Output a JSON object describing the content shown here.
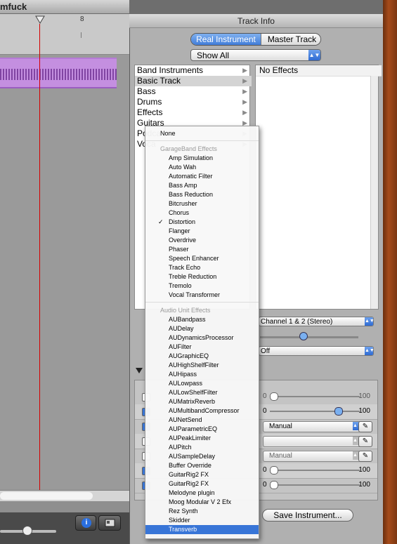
{
  "window": {
    "title_fragment": "mfuck"
  },
  "ruler": {
    "marker": "8"
  },
  "panel": {
    "title": "Track Info",
    "segments": [
      "Real Instrument",
      "Master Track"
    ],
    "filter": "Show All",
    "categories": [
      {
        "label": "Band Instruments",
        "selected": false
      },
      {
        "label": "Basic Track",
        "selected": true
      },
      {
        "label": "Bass",
        "selected": false
      },
      {
        "label": "Drums",
        "selected": false
      },
      {
        "label": "Effects",
        "selected": false
      },
      {
        "label": "Guitars",
        "selected": false
      },
      {
        "label": "Podca",
        "selected": false
      },
      {
        "label": "Voca",
        "selected": false
      }
    ],
    "effects_header": "No Effects",
    "input_source": "Channel 1 & 2 (Stereo)",
    "monitor": "Off",
    "save_button": "Save Instrument..."
  },
  "effects_rows": [
    {
      "checked": false,
      "type": "slider",
      "min": "0",
      "max": "100",
      "value": 0.0,
      "dim": true
    },
    {
      "checked": true,
      "type": "slider",
      "min": "0",
      "max": "100",
      "value": 0.78,
      "dim": false
    },
    {
      "checked": true,
      "type": "select",
      "value": "Manual",
      "dim": false
    },
    {
      "checked": false,
      "type": "select",
      "value": "",
      "dim": true
    },
    {
      "checked": false,
      "type": "select",
      "value": "Manual",
      "dim": true
    },
    {
      "checked": true,
      "type": "slider",
      "min": "0",
      "max": "100",
      "value": 0.0,
      "dim": false
    },
    {
      "checked": true,
      "type": "slider",
      "min": "0",
      "max": "100",
      "value": 0.0,
      "dim": false
    }
  ],
  "menu": {
    "none": "None",
    "garageband_header": "GarageBand Effects",
    "garageband": [
      "Amp Simulation",
      "Auto Wah",
      "Automatic Filter",
      "Bass Amp",
      "Bass Reduction",
      "Bitcrusher",
      "Chorus",
      "Distortion",
      "Flanger",
      "Overdrive",
      "Phaser",
      "Speech Enhancer",
      "Track Echo",
      "Treble Reduction",
      "Tremolo",
      "Vocal Transformer"
    ],
    "checked_item": "Distortion",
    "audiounit_header": "Audio Unit Effects",
    "audiounit": [
      "AUBandpass",
      "AUDelay",
      "AUDynamicsProcessor",
      "AUFilter",
      "AUGraphicEQ",
      "AUHighShelfFilter",
      "AUHipass",
      "AULowpass",
      "AULowShelfFilter",
      "AUMatrixReverb",
      "AUMultibandCompressor",
      "AUNetSend",
      "AUParametricEQ",
      "AUPeakLimiter",
      "AUPitch",
      "AUSampleDelay",
      "Buffer Override",
      "GuitarRig2 FX",
      "GuitarRig2 FX",
      "Melodyne plugin",
      "Moog Modular V 2 Efx",
      "Rez Synth",
      "Skidder",
      "Transverb"
    ],
    "highlighted_item": "Transverb"
  },
  "icons": {
    "info": "info-icon",
    "media": "media-browser-icon",
    "pencil": "pencil-icon"
  },
  "colors": {
    "accent": "#3875d7",
    "region": "#c48fe0",
    "playhead": "#d40000"
  }
}
